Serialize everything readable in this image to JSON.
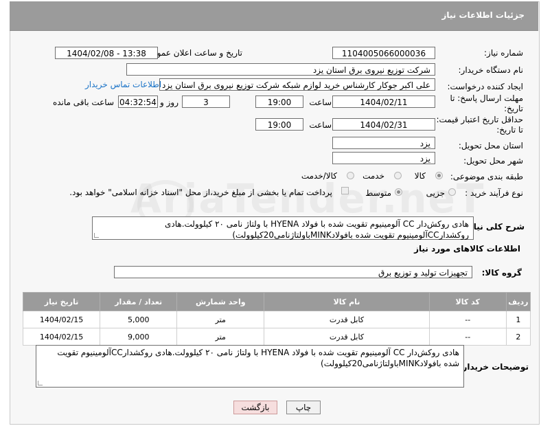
{
  "header": {
    "title": "جزئیات اطلاعات نیاز"
  },
  "watermark": "AriaTender.neT",
  "fields": {
    "need_number_label": "شماره نیاز:",
    "need_number": "1104005066000036",
    "announce_label": "تاریخ و ساعت اعلان عمومی:",
    "announce_value": "1404/02/08 - 13:38",
    "buyer_org_label": "نام دستگاه خریدار:",
    "buyer_org": "شرکت توزیع نیروی برق استان یزد",
    "creator_label": "ایجاد کننده درخواست:",
    "creator": "علی اکبر  جوکار  کارشناس خرید لوازم شبکه  شرکت توزیع نیروی برق استان یزد",
    "contact_link": "اطلاعات تماس خریدار",
    "deadline_label": "مهلت ارسال پاسخ: تا تاریخ:",
    "deadline_date": "1404/02/11",
    "time_label": "ساعت",
    "deadline_time": "19:00",
    "days_value": "3",
    "days_label": "روز و",
    "remaining_time": "04:32:54",
    "remaining_label": "ساعت باقی مانده",
    "validity_label": "حداقل تاریخ اعتبار قیمت: تا تاریخ:",
    "validity_date": "1404/02/31",
    "validity_time_label": "ساعت",
    "validity_time": "19:00",
    "province_label": "استان محل تحویل:",
    "province": "یزد",
    "city_label": "شهر محل تحویل:",
    "city": "یزد",
    "category_label": "طبقه بندی موضوعی:",
    "category_options": [
      "کالا",
      "خدمت",
      "کالا/خدمت"
    ],
    "process_label": "نوع فرآیند خرید :",
    "process_options": [
      "جزیی",
      "متوسط"
    ],
    "payment_note": "پرداخت تمام یا بخشی از مبلغ خرید،از محل \"اسناد خزانه اسلامی\" خواهد بود."
  },
  "description": {
    "label": "شرح کلی نیاز:",
    "text": "هادی روکش‌دار CC آلومینیوم تقویت شده با فولاد HYENA با ولتاژ نامی ۲۰ کیلوولت.هادی روکشدارCCآلومینیوم تقویت شده بافولادMINKباولتاژنامی20کیلوولت)"
  },
  "goods_section": {
    "title": "اطلاعات کالاهای مورد نیاز",
    "group_label": "گروه کالا:",
    "group_value": "تجهیزات تولید و توزیع برق"
  },
  "table": {
    "headers": [
      "ردیف",
      "کد کالا",
      "نام کالا",
      "واحد شمارش",
      "تعداد / مقدار",
      "تاریخ نیاز"
    ],
    "rows": [
      [
        "1",
        "--",
        "کابل قدرت",
        "متر",
        "5,000",
        "1404/02/15"
      ],
      [
        "2",
        "--",
        "کابل قدرت",
        "متر",
        "9,000",
        "1404/02/15"
      ]
    ]
  },
  "buyer_notes": {
    "label": "توضیحات خریدار:",
    "text": "هادی روکش‌دار CC آلومینیوم تقویت شده با فولاد HYENA با ولتاژ نامی ۲۰ کیلوولت.هادی روکشدارCCآلومینیوم تقویت شده بافولادMINKباولتاژنامی20کیلوولت)"
  },
  "buttons": {
    "print": "چاپ",
    "back": "بازگشت"
  }
}
